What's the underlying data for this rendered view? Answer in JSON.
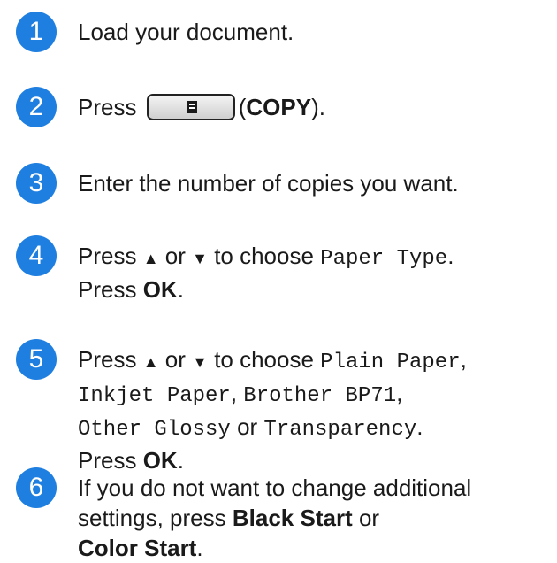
{
  "steps": [
    {
      "number": "1",
      "text": "Load your document."
    },
    {
      "number": "2",
      "press": "Press",
      "key_icon": "copy-key-icon",
      "key_label": "COPY",
      "open": "(",
      "close": ")."
    },
    {
      "number": "3",
      "text": "Enter the number of copies you want."
    },
    {
      "number": "4",
      "press": "Press",
      "up": "▲",
      "or": "or",
      "down": "▼",
      "to_choose": "to choose",
      "option": "Paper Type",
      "period": ".",
      "press_ok": "Press",
      "ok": "OK",
      "ok_period": "."
    },
    {
      "number": "5",
      "press": "Press",
      "up": "▲",
      "or": "or",
      "down": "▼",
      "to_choose": "to choose",
      "options": [
        "Plain Paper",
        "Inkjet Paper",
        "Brother BP71",
        "Other Glossy",
        "Transparency"
      ],
      "comma": ",",
      "or_word": "or",
      "period": ".",
      "press_ok": "Press",
      "ok": "OK",
      "ok_period": "."
    },
    {
      "number": "6",
      "line1": "If you do not want to change additional",
      "line2_pre": "settings, press",
      "black_start": "Black Start",
      "line2_post": "or",
      "color_start": "Color Start",
      "end": "."
    }
  ]
}
